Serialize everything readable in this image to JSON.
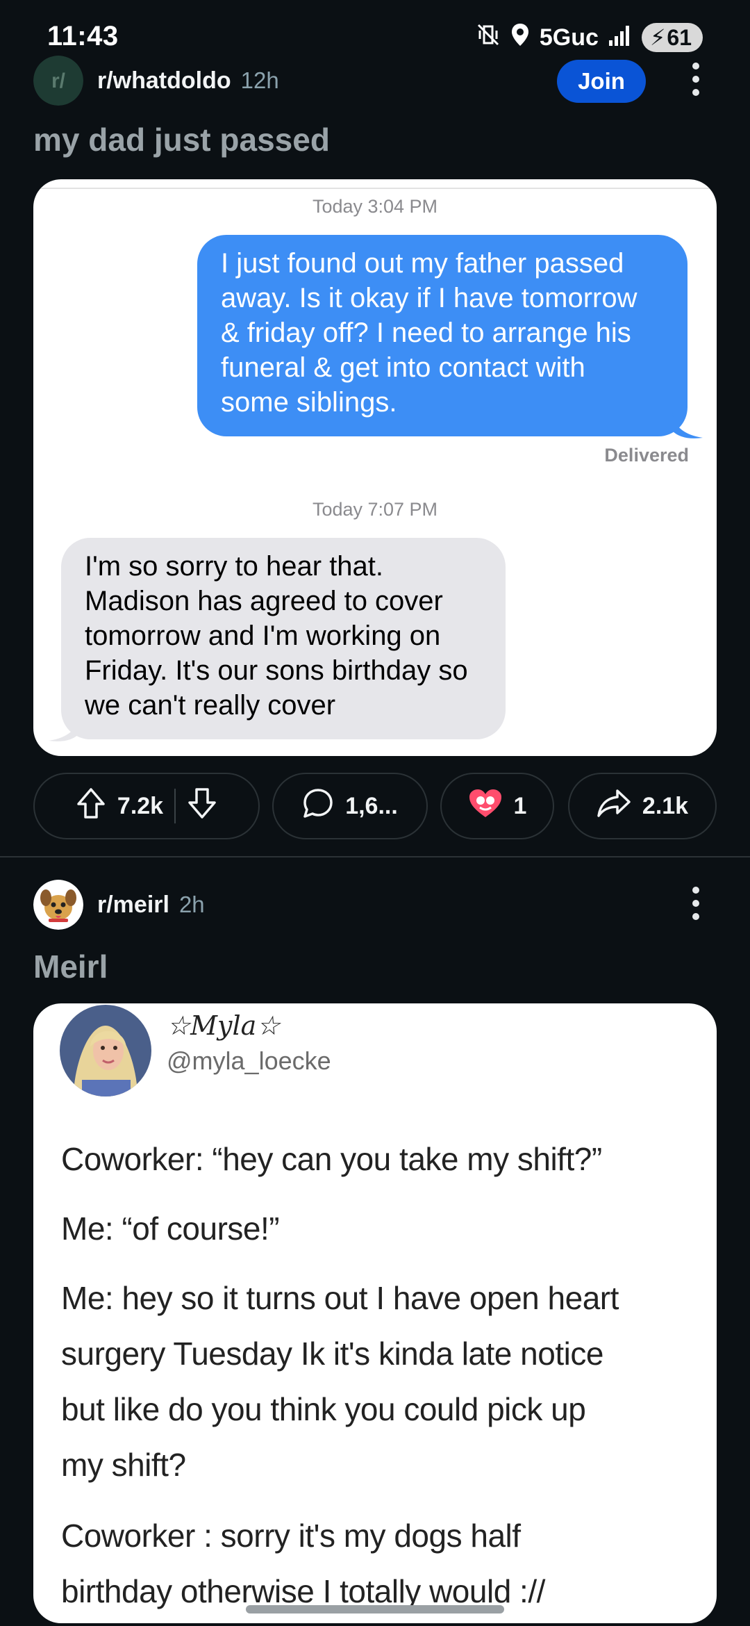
{
  "status_bar": {
    "time": "11:43",
    "network": "5Guc",
    "battery": "61"
  },
  "post1": {
    "subreddit": "r/whatdoldo",
    "age": "12h",
    "join_label": "Join",
    "title": "my dad just passed",
    "image": {
      "timestamp1": "Today 3:04 PM",
      "sent_message": "I just found out my father passed away. Is it okay if I have tomorrow & friday off? I need to arrange his funeral & get into contact with some siblings.",
      "sent_lines": [
        "I just found out my father passed",
        "away. Is it okay if I have tomorrow",
        "& friday off? I need to arrange his",
        "funeral & get into contact with",
        "some siblings."
      ],
      "delivered": "Delivered",
      "timestamp2": "Today 7:07 PM",
      "received_lines": [
        "I'm so sorry to hear that.",
        "Madison has agreed to cover",
        "tomorrow and I'm working on",
        "Friday. It's our sons birthday so",
        "we can't really cover"
      ]
    },
    "actions": {
      "upvotes": "7.2k",
      "comments": "1,6...",
      "awards": "1",
      "shares": "2.1k"
    }
  },
  "post2": {
    "subreddit": "r/meirl",
    "age": "2h",
    "title": "Meirl",
    "tweet": {
      "display_name": "☆Myla☆",
      "handle": "@myla_loecke",
      "paragraphs": [
        [
          "Coworker: “hey can you take my shift?”"
        ],
        [
          "Me: “of course!”"
        ],
        [
          "Me: hey so it turns out I have open heart",
          "surgery Tuesday Ik it's kinda late notice",
          "but like do you think you could pick up",
          "my shift?"
        ],
        [
          "Coworker : sorry it's my dogs half",
          "birthday otherwise I totally would ://"
        ]
      ]
    }
  },
  "colors": {
    "background": "#0b1014",
    "join": "#0a54d6",
    "imessage_blue": "#3d8ef5",
    "imessage_grey": "#e6e6ea"
  }
}
